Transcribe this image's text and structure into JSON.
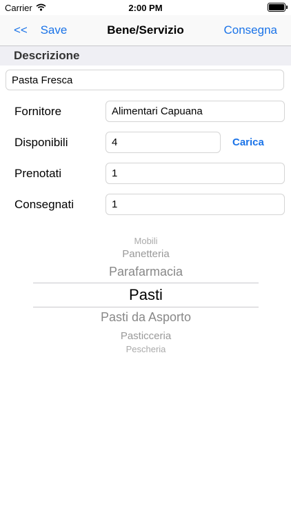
{
  "status_bar": {
    "carrier": "Carrier",
    "time": "2:00 PM"
  },
  "nav": {
    "back": "<<",
    "save": "Save",
    "title": "Bene/Servizio",
    "action": "Consegna"
  },
  "section": {
    "title": "Descrizione"
  },
  "description": {
    "value": "Pasta Fresca"
  },
  "rows": [
    {
      "label": "Fornitore",
      "value": "Alimentari Capuana"
    },
    {
      "label": "Disponibili",
      "value": "4"
    },
    {
      "label": "Prenotati",
      "value": "1"
    },
    {
      "label": "Consegnati",
      "value": "1"
    }
  ],
  "carica_label": "Carica",
  "picker": {
    "items": [
      "Mobili",
      "Panetteria",
      "Parafarmacia",
      "Pasti",
      "Pasti da Asporto",
      "Pasticceria",
      "Pescheria"
    ],
    "selected": "Pasti"
  },
  "colors": {
    "accent": "#1a73e8",
    "separator": "#c8c7cc",
    "section_bg": "#efeff4"
  }
}
